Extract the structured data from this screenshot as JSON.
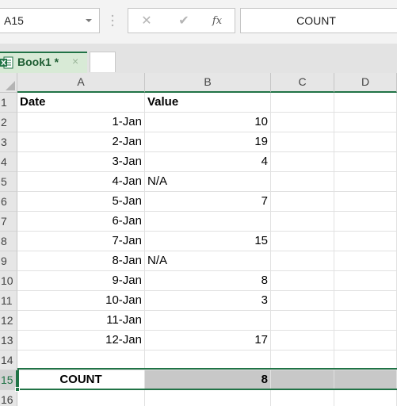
{
  "formula_bar": {
    "name_box": "A15",
    "cancel_icon": "close-icon",
    "enter_icon": "check-icon",
    "fx_label": "fx",
    "content": "COUNT"
  },
  "tabs": {
    "active_tab": "Book1 *",
    "close_glyph": "×"
  },
  "columns": [
    "A",
    "B",
    "C",
    "D"
  ],
  "rows": [
    {
      "num": "1",
      "a": "Date",
      "b": "Value",
      "header": true
    },
    {
      "num": "2",
      "a": "1-Jan",
      "b": "10"
    },
    {
      "num": "3",
      "a": "2-Jan",
      "b": "19"
    },
    {
      "num": "4",
      "a": "3-Jan",
      "b": "4"
    },
    {
      "num": "5",
      "a": "4-Jan",
      "b": "N/A",
      "b_text": true
    },
    {
      "num": "6",
      "a": "5-Jan",
      "b": "7"
    },
    {
      "num": "7",
      "a": "6-Jan",
      "b": ""
    },
    {
      "num": "8",
      "a": "7-Jan",
      "b": "15"
    },
    {
      "num": "9",
      "a": "8-Jan",
      "b": "N/A",
      "b_text": true
    },
    {
      "num": "10",
      "a": "9-Jan",
      "b": "8"
    },
    {
      "num": "11",
      "a": "10-Jan",
      "b": "3"
    },
    {
      "num": "12",
      "a": "11-Jan",
      "b": ""
    },
    {
      "num": "13",
      "a": "12-Jan",
      "b": "17"
    },
    {
      "num": "14",
      "a": "",
      "b": ""
    },
    {
      "num": "15",
      "a": "COUNT",
      "b": "8",
      "selected": true
    },
    {
      "num": "16",
      "a": "",
      "b": ""
    }
  ],
  "colors": {
    "accent": "#217346",
    "selection_fill": "#c8c8c8"
  }
}
